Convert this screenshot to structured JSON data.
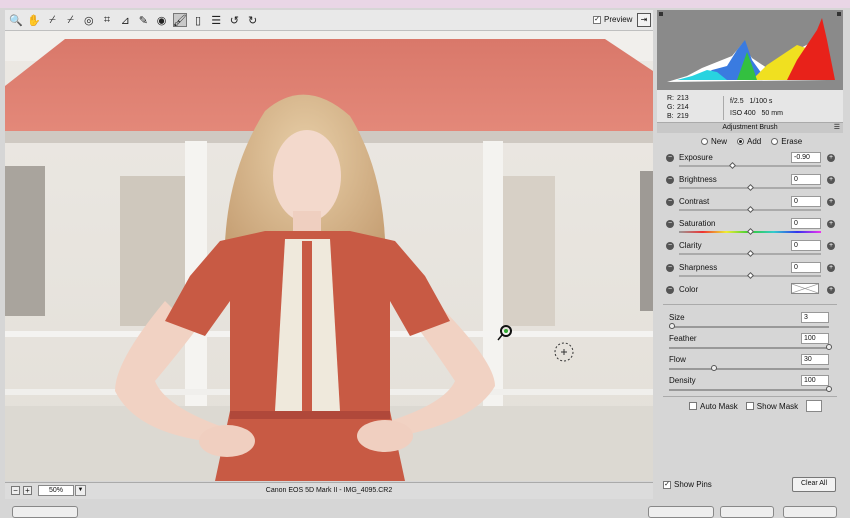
{
  "toolbar": {
    "tools": [
      {
        "name": "zoom-icon",
        "glyph": "🔍"
      },
      {
        "name": "hand-icon",
        "glyph": "✋"
      },
      {
        "name": "white-balance-icon",
        "glyph": "⌿"
      },
      {
        "name": "color-sampler-icon",
        "glyph": "⌿"
      },
      {
        "name": "target-adjust-icon",
        "glyph": "◎"
      },
      {
        "name": "crop-icon",
        "glyph": "⌗"
      },
      {
        "name": "straighten-icon",
        "glyph": "⊿"
      },
      {
        "name": "spot-removal-icon",
        "glyph": "✎"
      },
      {
        "name": "red-eye-icon",
        "glyph": "◉"
      },
      {
        "name": "adjustment-brush-icon",
        "glyph": "🖌"
      },
      {
        "name": "graduated-filter-icon",
        "glyph": "▯"
      },
      {
        "name": "preferences-icon",
        "glyph": "☰"
      },
      {
        "name": "rotate-left-icon",
        "glyph": "↺"
      },
      {
        "name": "rotate-right-icon",
        "glyph": "↻"
      }
    ],
    "preview_label": "Preview",
    "preview_checked": true
  },
  "bottombar": {
    "zoom_value": "50%",
    "caption": "Canon EOS 5D Mark II  -  IMG_4095.CR2"
  },
  "info": {
    "r_label": "R:",
    "r": "213",
    "g_label": "G:",
    "g": "214",
    "b_label": "B:",
    "b": "219",
    "aperture": "f/2.5",
    "shutter": "1/100 s",
    "iso": "ISO 400",
    "focal": "50 mm"
  },
  "panel": {
    "title": "Adjustment Brush",
    "modes": [
      {
        "label": "New",
        "selected": false
      },
      {
        "label": "Add",
        "selected": true
      },
      {
        "label": "Erase",
        "selected": false
      }
    ],
    "adjustments": [
      {
        "label": "Exposure",
        "value": "-0.90",
        "pos": 0.38
      },
      {
        "label": "Brightness",
        "value": "0",
        "pos": 0.5
      },
      {
        "label": "Contrast",
        "value": "0",
        "pos": 0.5
      },
      {
        "label": "Saturation",
        "value": "0",
        "pos": 0.5
      },
      {
        "label": "Clarity",
        "value": "0",
        "pos": 0.5
      },
      {
        "label": "Sharpness",
        "value": "0",
        "pos": 0.5
      }
    ],
    "color_label": "Color",
    "brush": [
      {
        "label": "Size",
        "value": "3",
        "pos": 0.02
      },
      {
        "label": "Feather",
        "value": "100",
        "pos": 1.0
      },
      {
        "label": "Flow",
        "value": "30",
        "pos": 0.28
      },
      {
        "label": "Density",
        "value": "100",
        "pos": 1.0
      }
    ],
    "auto_mask_label": "Auto Mask",
    "show_mask_label": "Show Mask",
    "show_pins_label": "Show Pins",
    "show_pins_checked": true,
    "clear_all_label": "Clear All"
  }
}
